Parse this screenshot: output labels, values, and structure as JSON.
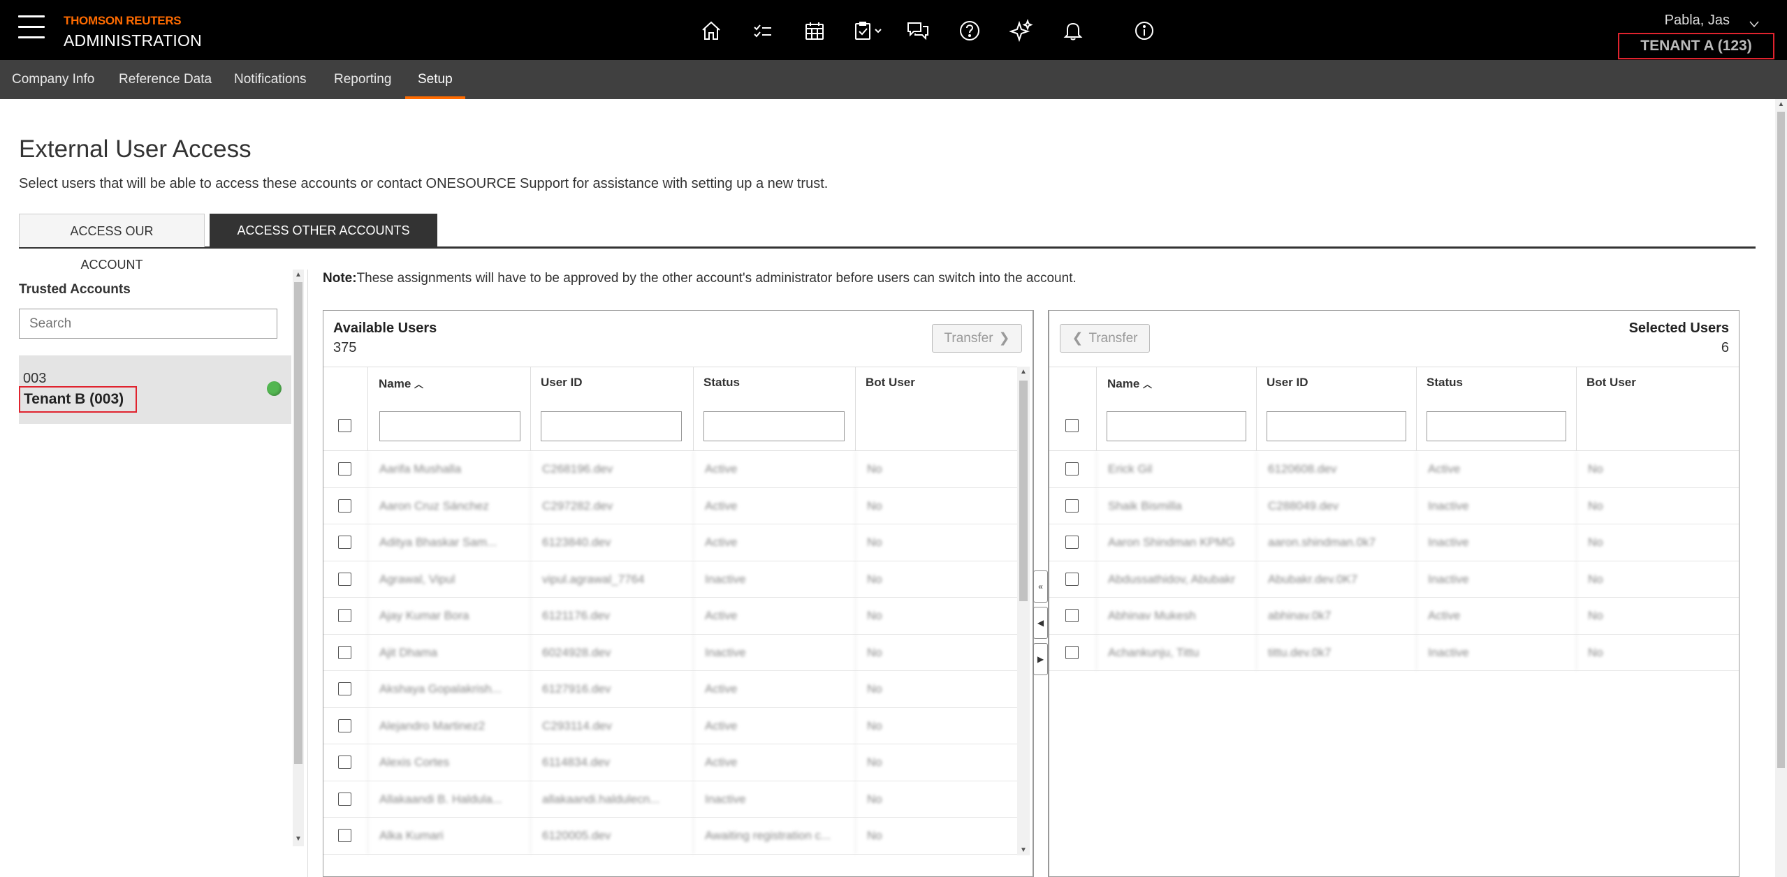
{
  "header": {
    "brand_top": "THOMSON REUTERS",
    "brand_bottom": "ADMINISTRATION",
    "user_name": "Pabla, Jas",
    "tenant": "TENANT A (123)",
    "icons": [
      "home-icon",
      "checklist-icon",
      "calendar-icon",
      "task-icon",
      "chat-icon",
      "help-icon",
      "sparkle-icon",
      "bell-icon",
      "info-icon"
    ]
  },
  "subnav": {
    "items": [
      "Company Info",
      "Reference Data",
      "Notifications",
      "Reporting",
      "Setup"
    ],
    "active": "Setup"
  },
  "page": {
    "title": "External User Access",
    "description": "Select users that will be able to access these accounts or contact ONESOURCE Support for assistance with setting up a new trust.",
    "tabs": [
      "ACCESS OUR ACCOUNT",
      "ACCESS OTHER ACCOUNTS"
    ],
    "active_tab": "ACCESS OTHER ACCOUNTS"
  },
  "trusted": {
    "label": "Trusted Accounts",
    "search_placeholder": "Search",
    "accounts": [
      {
        "code": "003",
        "name": "Tenant B  (003)",
        "status_color": "#53b651"
      }
    ]
  },
  "note": {
    "label": "Note:",
    "text": "These assignments will have to be approved by the other account's administrator before users can switch into the account."
  },
  "available": {
    "title": "Available Users",
    "count": "375",
    "transfer_label": "Transfer",
    "columns": [
      "Name",
      "User ID",
      "Status",
      "Bot User"
    ],
    "rows": [
      [
        "Aarifa Mushalla",
        "C268196.dev",
        "Active",
        "No"
      ],
      [
        "Aaron Cruz Sánchez",
        "C297282.dev",
        "Active",
        "No"
      ],
      [
        "Aditya Bhaskar Sam...",
        "6123840.dev",
        "Active",
        "No"
      ],
      [
        "Agrawal, Vipul",
        "vipul.agrawal_7764",
        "Inactive",
        "No"
      ],
      [
        "Ajay Kumar Bora",
        "6121176.dev",
        "Active",
        "No"
      ],
      [
        "Ajit Dhama",
        "6024928.dev",
        "Inactive",
        "No"
      ],
      [
        "Akshaya Gopalakrish...",
        "6127916.dev",
        "Active",
        "No"
      ],
      [
        "Alejandro Martinez2",
        "C293114.dev",
        "Active",
        "No"
      ],
      [
        "Alexis Cortes",
        "6114834.dev",
        "Active",
        "No"
      ],
      [
        "Allakaandi B. Haldula...",
        "allakaandi.haldulecn...",
        "Inactive",
        "No"
      ],
      [
        "Alka Kumari",
        "6120005.dev",
        "Awaiting registration c...",
        "No"
      ]
    ]
  },
  "selected": {
    "title": "Selected Users",
    "count": "6",
    "transfer_label": "Transfer",
    "columns": [
      "Name",
      "User ID",
      "Status",
      "Bot User"
    ],
    "rows": [
      [
        "Erick Gil",
        "6120608.dev",
        "Active",
        "No"
      ],
      [
        "Shaik Bismilla",
        "C288049.dev",
        "Inactive",
        "No"
      ],
      [
        "Aaron Shindman KPMG",
        "aaron.shindman.0k7",
        "Inactive",
        "No"
      ],
      [
        "Abdussathidov, Abubakr",
        "Abubakr.dev.0K7",
        "Inactive",
        "No"
      ],
      [
        "Abhinav Mukesh",
        "abhinav.0k7",
        "Active",
        "No"
      ],
      [
        "Achankunju, Tittu",
        "tittu.dev.0k7",
        "Inactive",
        "No"
      ]
    ]
  }
}
